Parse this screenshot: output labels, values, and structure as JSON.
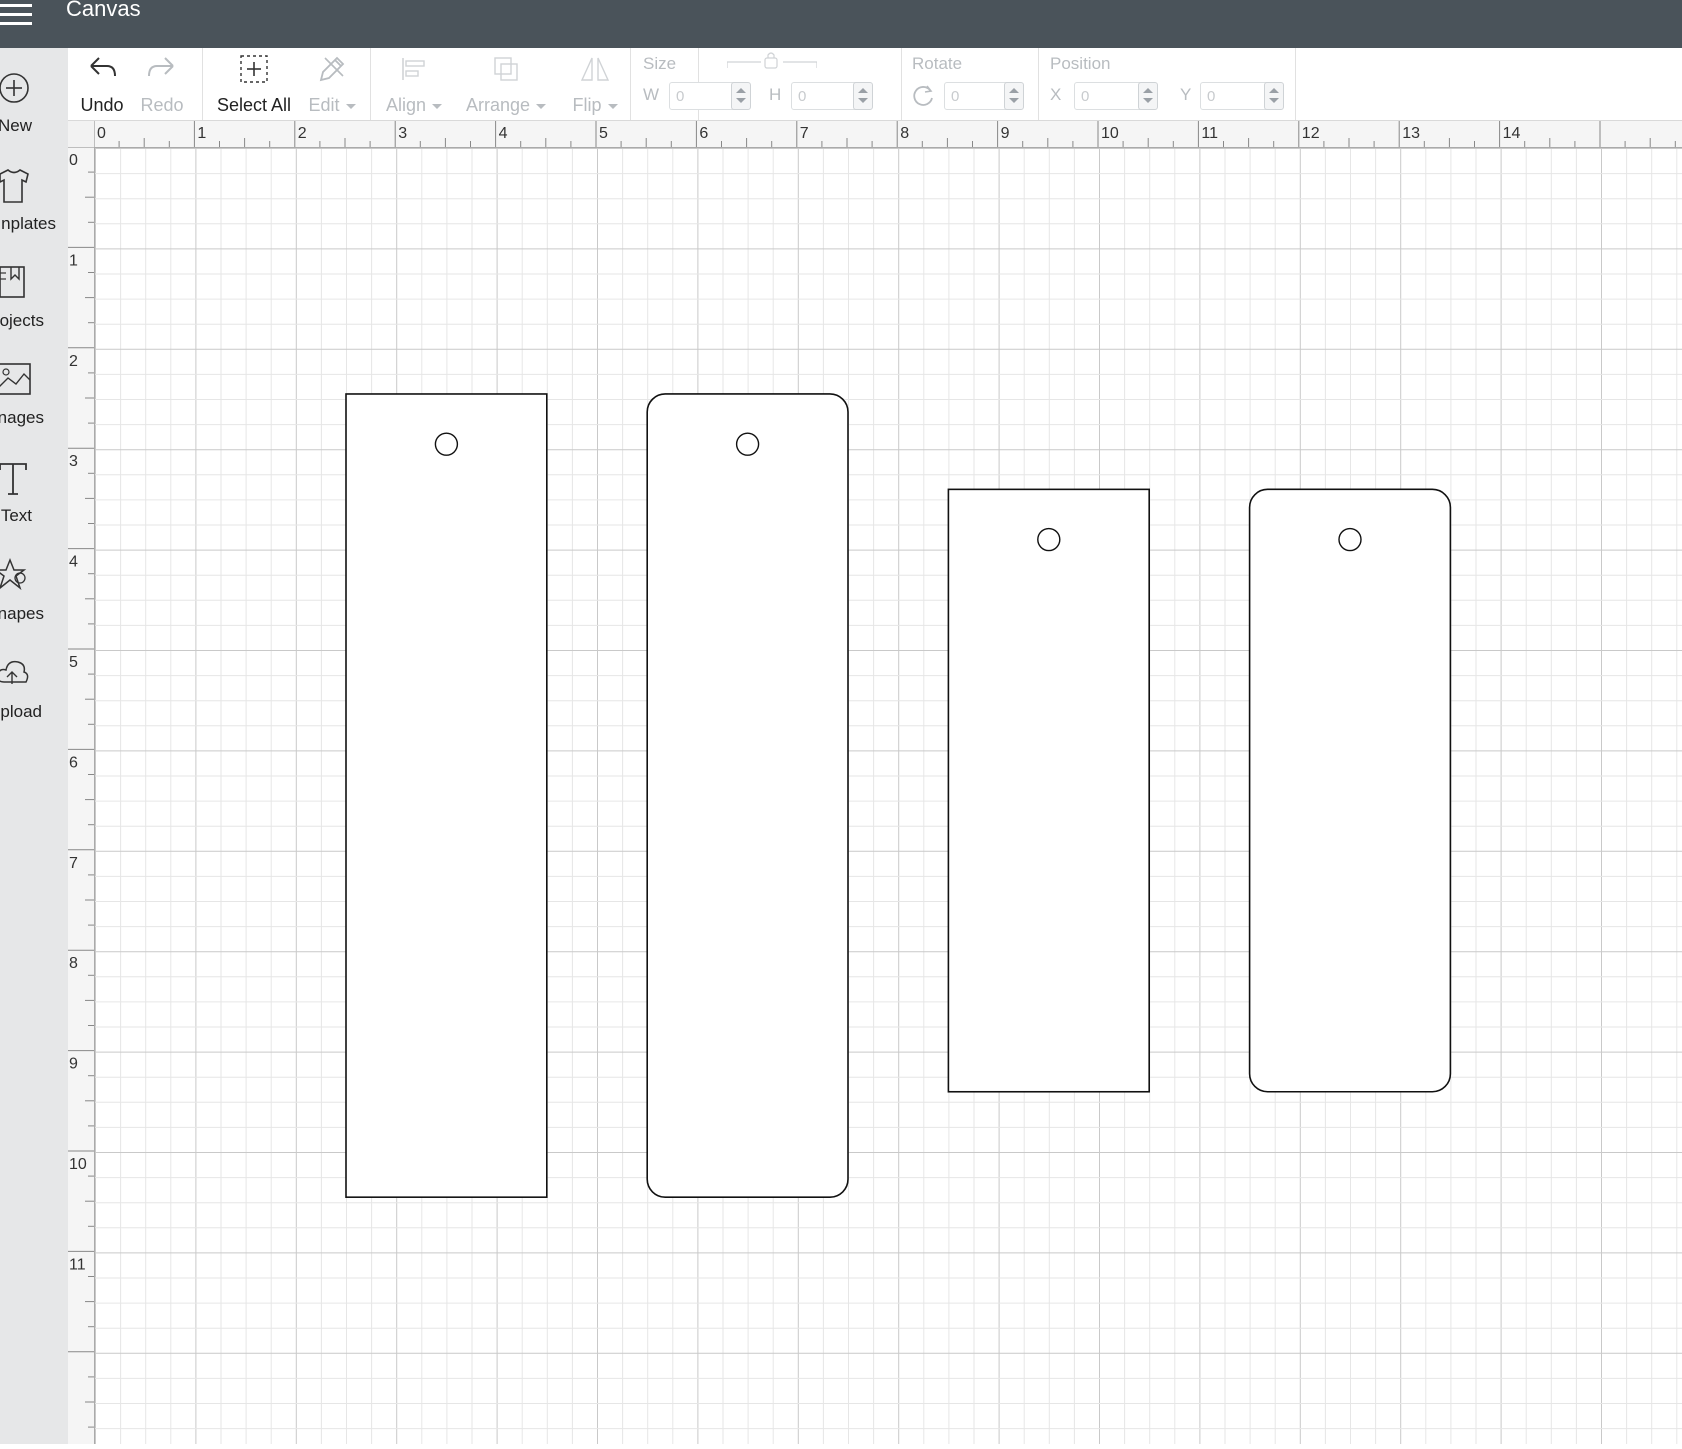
{
  "app": {
    "title": "Canvas"
  },
  "sidebar": {
    "items": [
      {
        "label": "New",
        "icon": "plus-circle-icon"
      },
      {
        "label": "nplates",
        "icon": "tshirt-icon"
      },
      {
        "label": "ojects",
        "icon": "bookmark-book-icon"
      },
      {
        "label": "nages",
        "icon": "image-icon"
      },
      {
        "label": "Text",
        "icon": "text-icon"
      },
      {
        "label": "napes",
        "icon": "shapes-icon"
      },
      {
        "label": "pload",
        "icon": "cloud-upload-icon"
      }
    ]
  },
  "toolbar": {
    "undo_label": "Undo",
    "redo_label": "Redo",
    "select_all_label": "Select All",
    "edit_label": "Edit",
    "align_label": "Align",
    "arrange_label": "Arrange",
    "flip_label": "Flip",
    "size": {
      "label": "Size",
      "w_label": "W",
      "h_label": "H",
      "w_value": "0",
      "h_value": "0"
    },
    "rotate": {
      "label": "Rotate",
      "value": "0"
    },
    "position": {
      "label": "Position",
      "x_label": "X",
      "y_label": "Y",
      "x_value": "0",
      "y_value": "0"
    }
  },
  "rulers": {
    "horizontal": [
      "0",
      "1",
      "2",
      "3",
      "4",
      "5",
      "6",
      "7",
      "8",
      "9",
      "10",
      "11",
      "12",
      "13",
      "14"
    ],
    "vertical": [
      "0",
      "1",
      "2",
      "3",
      "4",
      "5",
      "6",
      "7",
      "8",
      "9",
      "10",
      "11"
    ]
  },
  "colors": {
    "topbar": "#4a535a",
    "sidebar": "#e6e7e8",
    "grid_minor": "#e6e6e6",
    "grid_major": "#c9c9c9",
    "shape_stroke": "#111111"
  },
  "canvas": {
    "units": "inches",
    "shapes": [
      {
        "type": "rectangle-tag",
        "corners": "square",
        "x": 2.5,
        "y": 2.45,
        "w": 2.0,
        "h": 8.0
      },
      {
        "type": "rectangle-tag",
        "corners": "rounded",
        "x": 5.5,
        "y": 2.45,
        "w": 2.0,
        "h": 8.0
      },
      {
        "type": "rectangle-tag",
        "corners": "square",
        "x": 8.5,
        "y": 3.4,
        "w": 2.0,
        "h": 6.0
      },
      {
        "type": "rectangle-tag",
        "corners": "rounded",
        "x": 11.5,
        "y": 3.4,
        "w": 2.0,
        "h": 6.0
      }
    ]
  }
}
